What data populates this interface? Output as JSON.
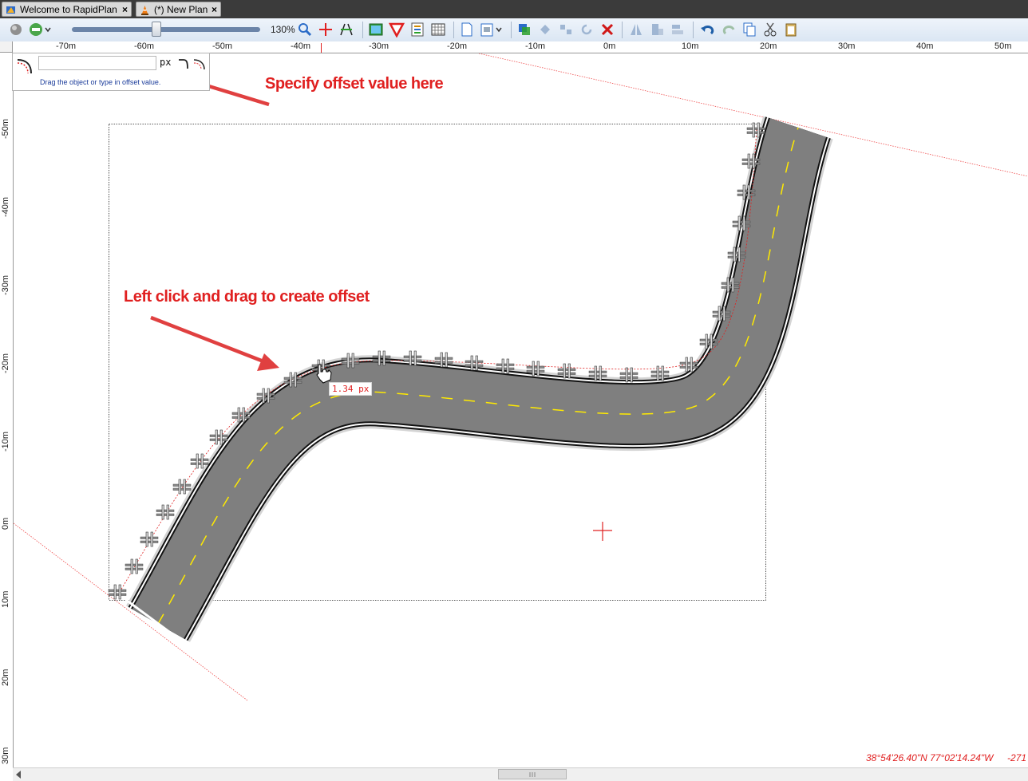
{
  "tabs": [
    {
      "label": "Welcome to RapidPlan",
      "close": "×",
      "icon": "rapidplan-logo-icon"
    },
    {
      "label": "(*) New Plan",
      "close": "×",
      "icon": "traffic-cone-icon"
    }
  ],
  "toolbar": {
    "zoom_label": "130%",
    "zoom_level": 0.45,
    "icons": [
      "globe-icon",
      "map-layer-icon",
      "zoom-search-icon",
      "crosshair-icon",
      "road-icon",
      "picture-icon",
      "yield-sign-icon",
      "list-icon",
      "grid-icon",
      "page-icon",
      "page-settings-icon",
      "layer-select-icon",
      "arrange-icon",
      "group-icon",
      "rotate-icon",
      "delete-icon",
      "flip-icon",
      "align-icon",
      "distribute-icon",
      "undo-icon",
      "redo-icon",
      "copy-icon",
      "cut-icon",
      "paste-icon"
    ]
  },
  "ruler": {
    "horizontal": [
      "-70m",
      "-60m",
      "-50m",
      "-40m",
      "-30m",
      "-20m",
      "-10m",
      "0m",
      "10m",
      "20m",
      "30m",
      "40m",
      "50m"
    ],
    "vertical": [
      "-50m",
      "-40m",
      "-30m",
      "-20m",
      "-10m",
      "0m",
      "10m",
      "20m",
      "30m"
    ]
  },
  "offset_panel": {
    "value": "",
    "unit": "px",
    "hint": "Drag the object or type in offset value."
  },
  "annotations": {
    "offset_callout": "Specify offset value here",
    "drag_callout": "Left click and drag to create offset"
  },
  "drag_tooltip": "1.34 px",
  "status": {
    "coordinates": "38°54'26.40\"N 77°02'14.24\"W",
    "elevation": "-271"
  },
  "colors": {
    "road": "#7f7f7f",
    "centerline": "#ffea00",
    "shoulder": "#d4d4d4",
    "annotation": "#e02020",
    "toolbar": "#dbe6f3"
  }
}
